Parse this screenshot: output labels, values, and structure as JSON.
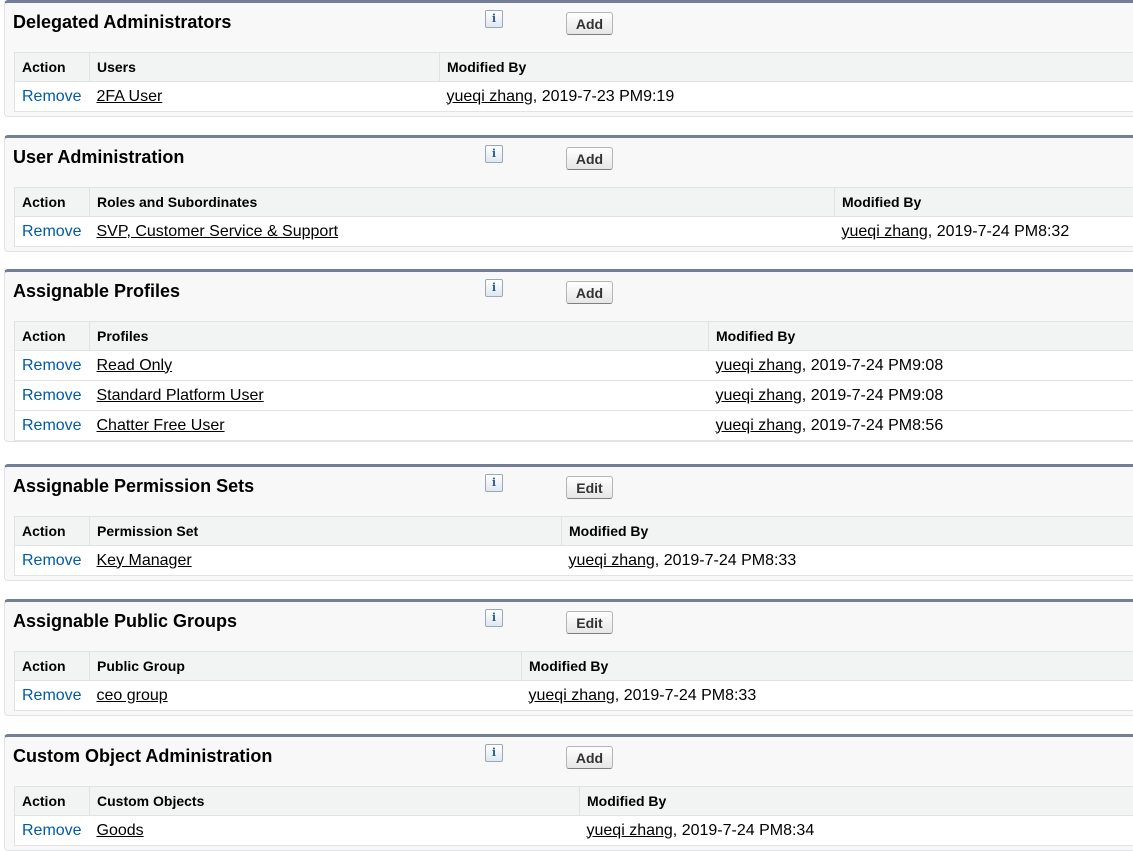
{
  "sections": [
    {
      "title": "Delegated Administrators",
      "button": "Add",
      "columns": [
        "Action",
        "Users",
        "Modified By"
      ],
      "rows": [
        {
          "action": "Remove",
          "item": "2FA User",
          "modified_by": "yueqi zhang",
          "modified_at": ", 2019-7-23 PM9:19"
        }
      ]
    },
    {
      "title": "User Administration",
      "button": "Add",
      "columns": [
        "Action",
        "Roles and Subordinates",
        "Modified By"
      ],
      "rows": [
        {
          "action": "Remove",
          "item": "SVP, Customer Service & Support",
          "modified_by": "yueqi zhang",
          "modified_at": ", 2019-7-24 PM8:32"
        }
      ]
    },
    {
      "title": "Assignable Profiles",
      "button": "Add",
      "columns": [
        "Action",
        "Profiles",
        "Modified By"
      ],
      "rows": [
        {
          "action": "Remove",
          "item": "Read Only",
          "modified_by": "yueqi zhang",
          "modified_at": ", 2019-7-24 PM9:08"
        },
        {
          "action": "Remove",
          "item": "Standard Platform User",
          "modified_by": "yueqi zhang",
          "modified_at": ", 2019-7-24 PM9:08"
        },
        {
          "action": "Remove",
          "item": "Chatter Free User",
          "modified_by": "yueqi zhang",
          "modified_at": ", 2019-7-24 PM8:56"
        }
      ]
    },
    {
      "title": "Assignable Permission Sets",
      "button": "Edit",
      "columns": [
        "Action",
        "Permission Set",
        "Modified By"
      ],
      "rows": [
        {
          "action": "Remove",
          "item": "Key Manager",
          "modified_by": "yueqi zhang",
          "modified_at": ", 2019-7-24 PM8:33"
        }
      ]
    },
    {
      "title": "Assignable Public Groups",
      "button": "Edit",
      "columns": [
        "Action",
        "Public Group",
        "Modified By"
      ],
      "rows": [
        {
          "action": "Remove",
          "item": "ceo group",
          "modified_by": "yueqi zhang",
          "modified_at": ", 2019-7-24 PM8:33"
        }
      ]
    },
    {
      "title": "Custom Object Administration",
      "button": "Add",
      "columns": [
        "Action",
        "Custom Objects",
        "Modified By"
      ],
      "rows": [
        {
          "action": "Remove",
          "item": "Goods",
          "modified_by": "yueqi zhang",
          "modified_at": ", 2019-7-24 PM8:34"
        }
      ]
    }
  ],
  "icons": {
    "info": "info-icon",
    "info_glyph": "i"
  }
}
